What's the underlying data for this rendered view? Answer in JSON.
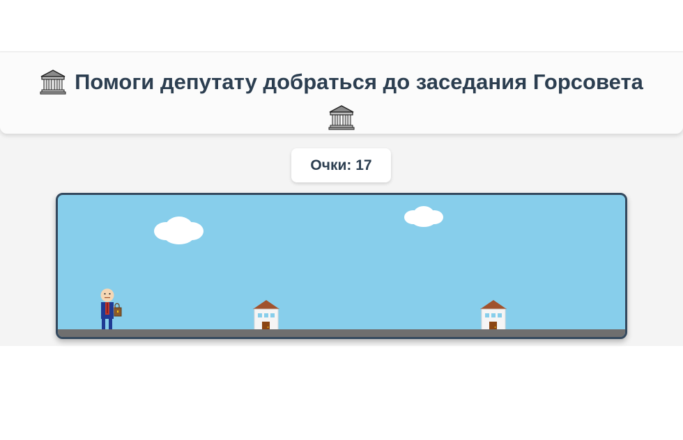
{
  "header": {
    "title": "Помоги депутату добраться до заседания Горсовета",
    "icon": "classical-building-icon"
  },
  "score": {
    "text": "Очки: 17",
    "label": "Очки",
    "value": 17
  },
  "game": {
    "sky_color": "#87ceeb",
    "ground_color": "#6f6f6f",
    "border_color": "#34495e",
    "player": {
      "icon": "deputy-with-briefcase",
      "shirt_color": "#c0392b",
      "suit_color": "#1f3a93",
      "skin_color": "#f5d7b5"
    },
    "obstacles": [
      {
        "type": "house",
        "roof_color": "#a0522d",
        "wall_color": "#f5f5f5",
        "door_color": "#8b4513",
        "window_color": "#87ceeb"
      },
      {
        "type": "house",
        "roof_color": "#a0522d",
        "wall_color": "#f5f5f5",
        "door_color": "#8b4513",
        "window_color": "#87ceeb"
      }
    ],
    "clouds": [
      {
        "type": "cloud"
      },
      {
        "type": "cloud"
      }
    ]
  }
}
